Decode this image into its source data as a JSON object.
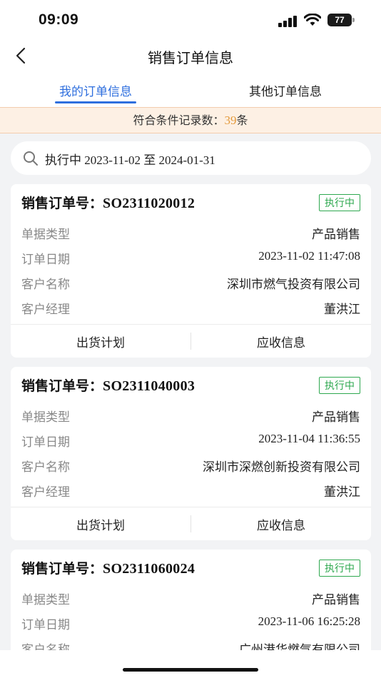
{
  "status_bar": {
    "time": "09:09",
    "battery": "77"
  },
  "nav": {
    "title": "销售订单信息"
  },
  "tabs": [
    {
      "label": "我的订单信息"
    },
    {
      "label": "其他订单信息"
    }
  ],
  "count_bar": {
    "prefix": "符合条件记录数：",
    "count": "39",
    "suffix": "条"
  },
  "search": {
    "text": "执行中 2023-11-02 至 2024-01-31"
  },
  "orders": [
    {
      "title_label": "销售订单号：",
      "order_no": "SO2311020012",
      "status": "执行中",
      "fields": [
        {
          "label": "单据类型",
          "value": "产品销售"
        },
        {
          "label": "订单日期",
          "value": "2023-11-02 11:47:08"
        },
        {
          "label": "客户名称",
          "value": "深圳市燃气投资有限公司"
        },
        {
          "label": "客户经理",
          "value": "董洪江"
        }
      ],
      "actions": [
        "出货计划",
        "应收信息"
      ]
    },
    {
      "title_label": "销售订单号：",
      "order_no": "SO2311040003",
      "status": "执行中",
      "fields": [
        {
          "label": "单据类型",
          "value": "产品销售"
        },
        {
          "label": "订单日期",
          "value": "2023-11-04 11:36:55"
        },
        {
          "label": "客户名称",
          "value": "深圳市深燃创新投资有限公司"
        },
        {
          "label": "客户经理",
          "value": "董洪江"
        }
      ],
      "actions": [
        "出货计划",
        "应收信息"
      ]
    },
    {
      "title_label": "销售订单号：",
      "order_no": "SO2311060024",
      "status": "执行中",
      "fields": [
        {
          "label": "单据类型",
          "value": "产品销售"
        },
        {
          "label": "订单日期",
          "value": "2023-11-06 16:25:28"
        },
        {
          "label": "客户名称",
          "value": "广州港华燃气有限公司"
        }
      ]
    }
  ],
  "colors": {
    "accent": "#2f6fde",
    "status_green": "#2ea84f",
    "count_orange": "#e49a3c",
    "count_bar_bg": "#fdf0e4"
  },
  "icons": {
    "back": "chevron-left-icon",
    "search": "search-icon",
    "signal": "signal-icon",
    "wifi": "wifi-icon",
    "battery": "battery-icon"
  }
}
